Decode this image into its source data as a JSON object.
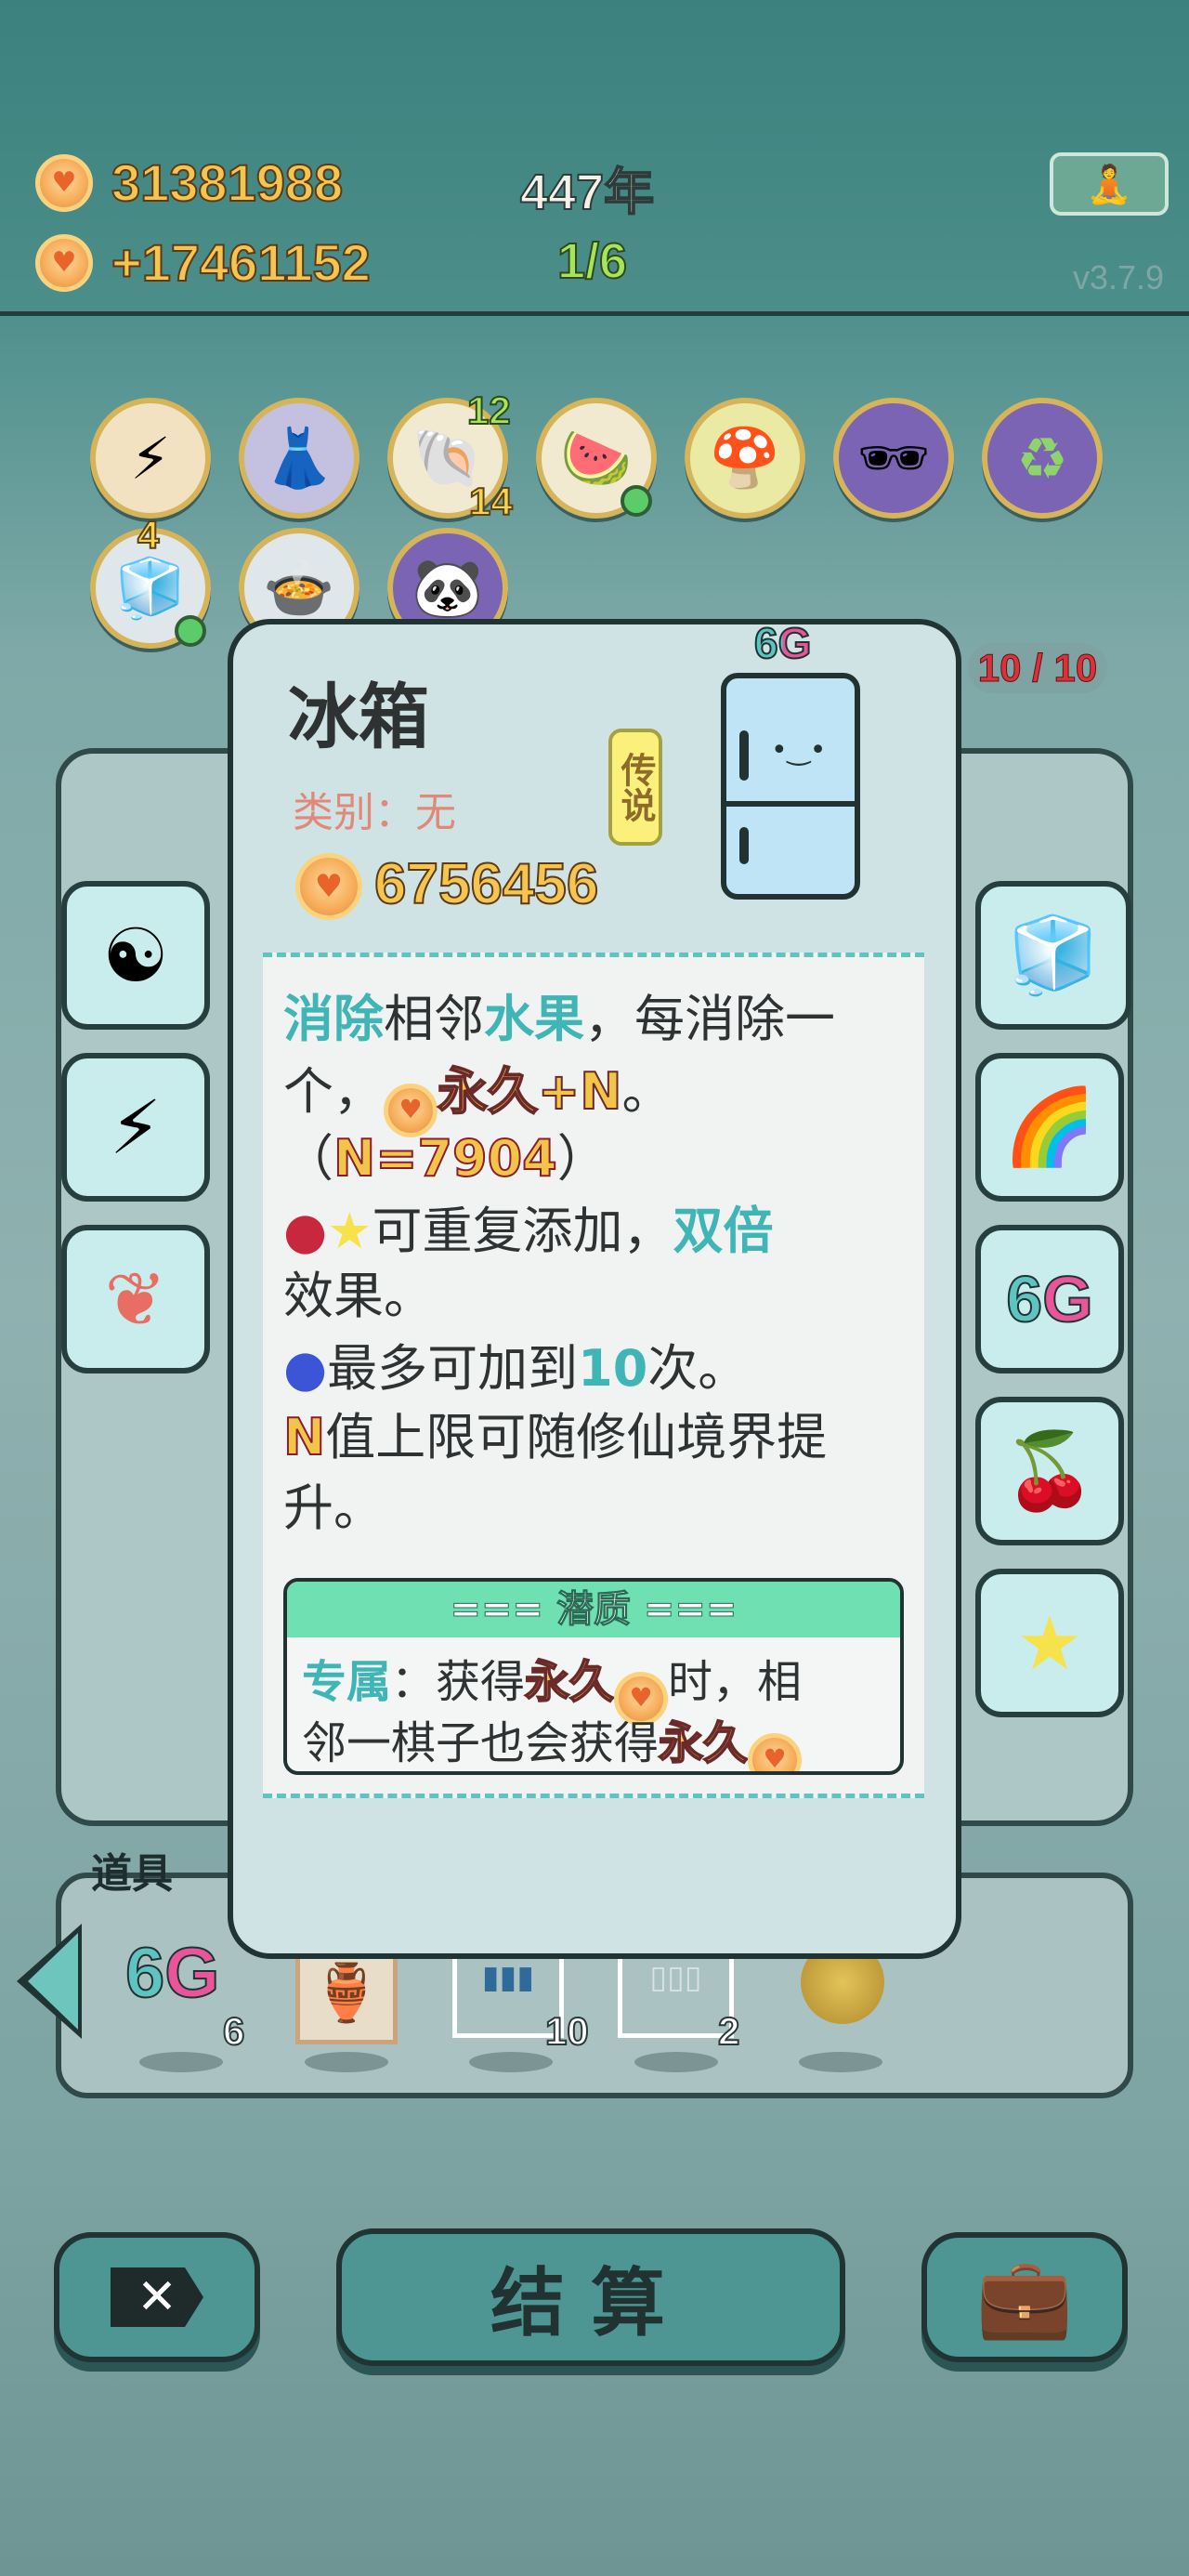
{
  "hud": {
    "coins": "31381988",
    "income": "+17461152",
    "year": "447年",
    "round": "1/6",
    "version": "v3.7.9"
  },
  "relics": {
    "shell_top": "12",
    "shell_bottom": "14",
    "tray_badge": "4"
  },
  "board": {
    "counter": "10 / 10"
  },
  "popup": {
    "title": "冰箱",
    "category": "类别：无",
    "rarity": "传说",
    "price": "6756456",
    "tag": "6G",
    "desc": {
      "l1a": "消除",
      "l1b": "相邻",
      "l1c": "水果",
      "l1d": "，每消除一",
      "l2a": "个，",
      "l2b": "永久+N",
      "l2c": "。",
      "l3a": "（",
      "l3b": "N=7904",
      "l3c": "）",
      "l4a": "可重复添加，",
      "l4b": "双倍",
      "l5": "效果。",
      "l6a": "最多可加到",
      "l6b": "10",
      "l6c": "次。",
      "l7a": "N",
      "l7b": "值上限可随修仙境界提",
      "l8": "升。"
    },
    "potential": {
      "header": "=== 潜质 ===",
      "p1a": "专属",
      "p1b": "：获得",
      "p1c": "永久",
      "p1d": "时，相",
      "p2a": "邻一棋子也会获得",
      "p2b": "永久"
    }
  },
  "items": {
    "label": "道具",
    "slot1_count": "6",
    "slot3_count": "10",
    "slot4_count": "2",
    "slot1_tag": "6G"
  },
  "buttons": {
    "settle": "结算"
  }
}
